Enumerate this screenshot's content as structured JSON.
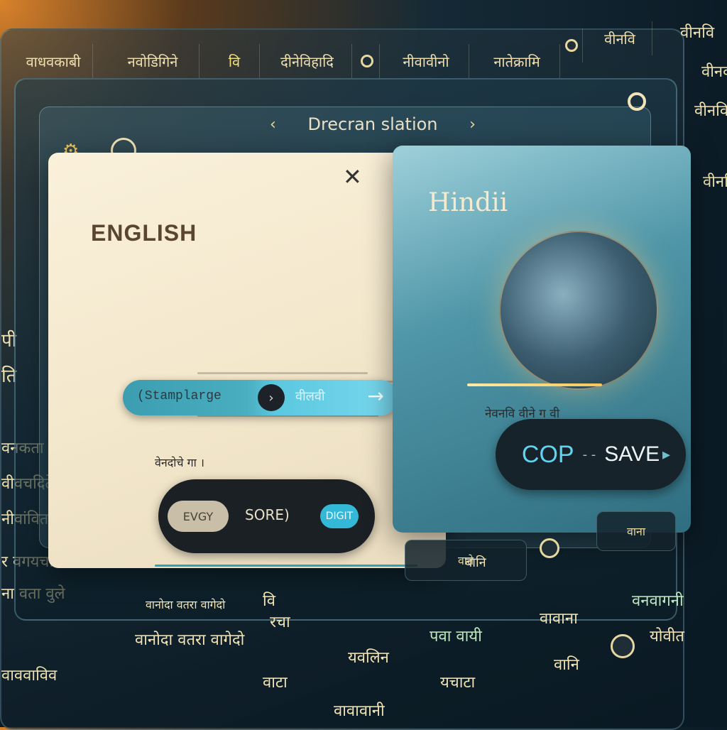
{
  "top_tabs": [
    {
      "label": "वाधवकाबी"
    },
    {
      "label": "नवोडिगिने"
    },
    {
      "label": "वि"
    },
    {
      "label": "दीनेविहादि"
    },
    {
      "label": "नीवावीनो"
    },
    {
      "label": "नातेक्रामि"
    },
    {
      "label": "वीनवि"
    }
  ],
  "title": "Drecran slation",
  "english_card": {
    "label": "ENGLISH",
    "input_placeholder": "(Stamplarge",
    "input_output": "वीलवी",
    "note": "वेनदोचे गा ।",
    "toggle_option_1": "EVGY",
    "toggle_option_2": "SORE)",
    "toggle_option_3": "DIGIT"
  },
  "hindi_card": {
    "label": "Hindii",
    "note": "नेवनवि वीने ग वी",
    "copy_label": "COP",
    "separator": "- -",
    "save_label": "SAVE"
  },
  "left_sidebar": [
    {
      "label": "पी"
    },
    {
      "label": "ति"
    },
    {
      "label": "वनकता"
    },
    {
      "label": "वीवचदिटे"
    },
    {
      "label": "नीवांविता"
    },
    {
      "label": "र वगयचा"
    },
    {
      "label": "ना वता वुले"
    },
    {
      "label": "वाववाविव"
    }
  ],
  "right_sidebar": [
    {
      "label": "वीनवि"
    },
    {
      "label": "वीनवी"
    },
    {
      "label": "वीनवि"
    },
    {
      "label": "वीनवि"
    }
  ],
  "bottom_items": [
    {
      "label": "वानोदा वतरा वागेदो"
    },
    {
      "label": "वानोदा वतरा वागेदो"
    },
    {
      "label": "वि"
    },
    {
      "label": "रचा"
    },
    {
      "label": "बानि"
    },
    {
      "label": "वावाना"
    },
    {
      "label": "वनवागनी"
    },
    {
      "label": "यवलिन"
    },
    {
      "label": "पवा वायी"
    },
    {
      "label": "वाटा"
    },
    {
      "label": "यचाटा"
    },
    {
      "label": "वानि"
    },
    {
      "label": "योवीत"
    },
    {
      "label": "वावावानी"
    }
  ],
  "small_controls": {
    "bottom_pill_1": "वाने",
    "bottom_pill_2": "वाना"
  }
}
